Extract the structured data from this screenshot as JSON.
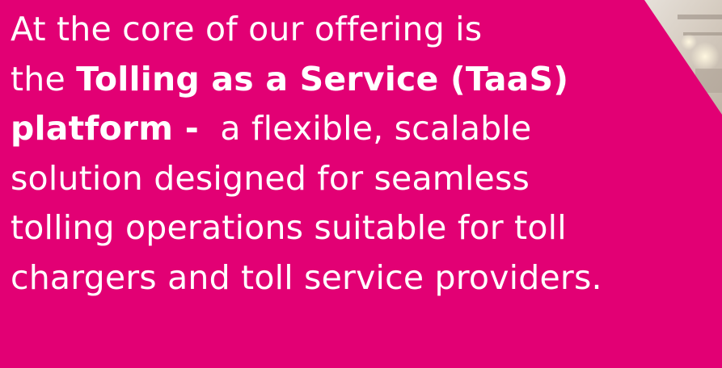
{
  "text": {
    "line1": "At the core of our offering is",
    "line2_prefix": "the ",
    "line2_bold": "Tolling as a Service (TaaS)",
    "line3_bold": "platform -",
    "line3_rest": "  a flexible, scalable",
    "line4": "solution designed for seamless",
    "line5": "tolling operations suitable for toll",
    "line6": "chargers and toll service providers."
  },
  "colors": {
    "background": "#E20074",
    "text": "#FFFFFF"
  }
}
